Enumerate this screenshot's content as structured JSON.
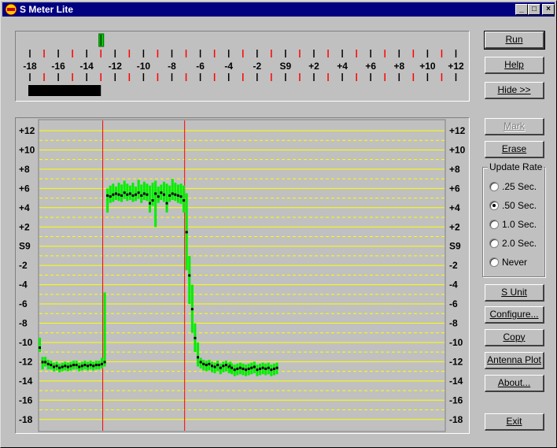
{
  "window": {
    "title": "S Meter Lite",
    "controls": [
      "minimize",
      "maximize",
      "close"
    ]
  },
  "meter": {
    "scale_labels": [
      "-18",
      "-16",
      "-14",
      "-12",
      "-10",
      "-8",
      "-6",
      "-4",
      "-2",
      "S9",
      "+2",
      "+4",
      "+6",
      "+8",
      "+10",
      "+12"
    ],
    "scale_min": -18,
    "scale_max": 12,
    "needle_value": -13,
    "bar_value": -13,
    "colors": {
      "major_tick": "#000000",
      "minor_tick": "#ff0000",
      "needle": "#00cc00",
      "bar": "#000000"
    }
  },
  "buttons": {
    "run": "Run",
    "help": "Help",
    "hide": "Hide >>",
    "mark": "Mark",
    "erase": "Erase",
    "s_unit": "S Unit",
    "configure": "Configure...",
    "copy": "Copy",
    "antenna_plot": "Antenna Plot",
    "about": "About...",
    "exit": "Exit"
  },
  "update_rate": {
    "title": "Update Rate",
    "options": [
      ".25 Sec.",
      ".50 Sec.",
      "1.0 Sec.",
      "2.0 Sec.",
      "Never"
    ],
    "selected": 1
  },
  "chart_data": {
    "type": "line",
    "y_labels": [
      "+12",
      "+10",
      "+8",
      "+6",
      "+4",
      "+2",
      "S9",
      "-2",
      "-4",
      "-6",
      "-8",
      "-10",
      "-12",
      "-14",
      "-16",
      "-18"
    ],
    "ylim": [
      -18,
      12
    ],
    "grid": "yellow horizontal every unit (solid at even, dashed at odd)",
    "markers_x": [
      23,
      52
    ],
    "x": [
      0,
      1,
      2,
      3,
      4,
      5,
      6,
      7,
      8,
      9,
      10,
      11,
      12,
      13,
      14,
      15,
      16,
      17,
      18,
      19,
      20,
      21,
      22,
      23,
      24,
      25,
      26,
      27,
      28,
      29,
      30,
      31,
      32,
      33,
      34,
      35,
      36,
      37,
      38,
      39,
      40,
      41,
      42,
      43,
      44,
      45,
      46,
      47,
      48,
      49,
      50,
      51,
      52,
      53,
      54,
      55,
      56,
      57,
      58,
      59,
      60,
      61,
      62,
      63,
      64,
      65,
      66,
      67,
      67.5,
      68,
      69,
      70,
      71,
      72,
      73,
      74,
      75,
      76,
      77,
      78,
      79,
      80,
      81,
      82,
      83,
      84
    ],
    "series": [
      {
        "values": [
          -10.5,
          -12,
          -12,
          -12.2,
          -12.3,
          -12.5,
          -12.4,
          -12.6,
          -12.5,
          -12.4,
          -12.5,
          -12.4,
          -12.3,
          -12.3,
          -12.5,
          -12.4,
          -12.3,
          -12.4,
          -12.3,
          -12.4,
          -12.3,
          -12.3,
          -12.2,
          -12,
          5.3,
          5.2,
          5.4,
          5.5,
          5.4,
          5.3,
          5.6,
          5.4,
          5.5,
          5.3,
          5.4,
          5.6,
          5.3,
          5.5,
          5.4,
          4.5,
          4.8,
          5.5,
          5.2,
          5.6,
          5.4,
          4.5,
          5.3,
          5.5,
          5.4,
          5.3,
          5.2,
          4.8,
          1.5,
          -3,
          -6.5,
          -9.5,
          -11.5,
          -12,
          -12.2,
          -12.3,
          -12.2,
          -12.4,
          -12.5,
          -12.3,
          -12.6,
          -12.4,
          -12.3,
          -12.5,
          -12.4,
          -12.6,
          -12.8,
          -12.7,
          -12.6,
          -12.7,
          -12.8,
          -12.7,
          -12.6,
          -12.5,
          -12.8,
          -12.7,
          -12.6,
          -12.7,
          -12.6,
          -12.8,
          -12.7,
          -12.6,
          -12.8,
          -12.7
        ],
        "min": [
          -11,
          -12.8,
          -12.5,
          -12.8,
          -12.8,
          -13,
          -12.9,
          -13.1,
          -13,
          -12.9,
          -13,
          -12.9,
          -12.8,
          -12.8,
          -13,
          -12.9,
          -12.8,
          -12.9,
          -12.8,
          -12.9,
          -12.8,
          -12.8,
          -12.7,
          -12.5,
          3.5,
          4.5,
          4.6,
          4.8,
          4.7,
          4.6,
          4.9,
          4.7,
          4.8,
          4.6,
          4.7,
          4.9,
          4.5,
          4.8,
          4.7,
          3.5,
          4.2,
          2,
          4.5,
          4.8,
          4.6,
          3.5,
          4.6,
          4.8,
          4.7,
          4.5,
          4.4,
          3.5,
          -2.5,
          -6,
          -9,
          -11,
          -12.5,
          -12.7,
          -12.9,
          -13,
          -12.9,
          -13.1,
          -13.2,
          -13,
          -13.3,
          -13.1,
          -13,
          -13.2,
          -13.1,
          -13.3,
          -13.5,
          -13.4,
          -13.3,
          -13.4,
          -13.5,
          -13.4,
          -13.3,
          -13.2,
          -13.5,
          -13.4,
          -13.3,
          -13.4,
          -13.3,
          -13.5,
          -13.4,
          -13.3,
          -13.5,
          -13.4
        ],
        "max": [
          -9.5,
          -11.5,
          -11.5,
          -11.8,
          -11.9,
          -12.1,
          -12,
          -12.2,
          -12.1,
          -12,
          -12.1,
          -12,
          -11.9,
          -11.9,
          -12.1,
          -12,
          -11.9,
          -12,
          -11.9,
          -12,
          -11.9,
          -11.9,
          -11.6,
          -4.8,
          6,
          6.3,
          6.5,
          6.2,
          6.6,
          6.4,
          6.8,
          6.5,
          6.3,
          6.6,
          6.2,
          6.9,
          6.4,
          6.7,
          6.5,
          6.3,
          6.6,
          6.8,
          6.2,
          6.4,
          6.7,
          6.5,
          6.3,
          7,
          6.6,
          6.4,
          6.5,
          6.3,
          5.5,
          -1,
          -4,
          -8,
          -10,
          -11.6,
          -11.8,
          -11.9,
          -11.8,
          -12,
          -12.1,
          -11.9,
          -12.2,
          -12,
          -11.9,
          -12.1,
          -12,
          -12.2,
          -12.3,
          -12.2,
          -12.1,
          -12.2,
          -12.3,
          -12.2,
          -12.1,
          -12,
          -12.3,
          -12.2,
          -12.1,
          -12.2,
          -12.1,
          -12.3,
          -12.2,
          -12.1,
          -12.3,
          -12.2
        ]
      }
    ],
    "colors": {
      "range": "#00ee00",
      "value": "#000000",
      "grid": "#ffff00",
      "marker": "#ff0000"
    }
  }
}
